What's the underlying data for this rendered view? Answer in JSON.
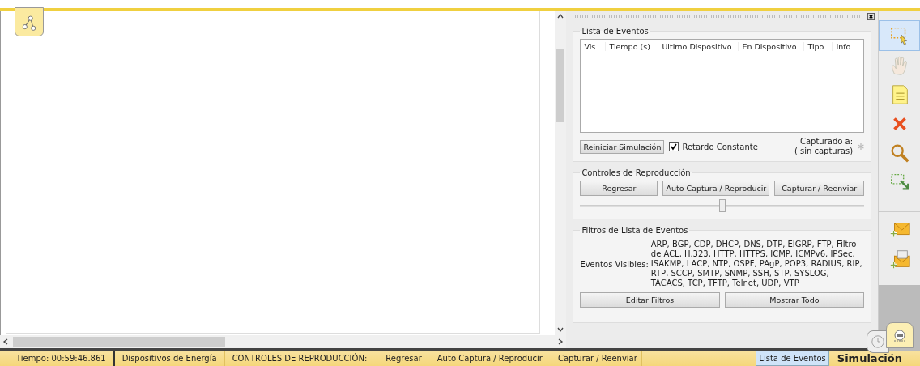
{
  "event_list": {
    "title": "Lista de Eventos",
    "columns": [
      "Vis.",
      "Tiempo (s)",
      "Ultimo Dispositivo",
      "En Dispositivo",
      "Tipo",
      "Info"
    ],
    "reset_button": "Reiniciar Simulación",
    "constant_delay": {
      "label": "Retardo Constante",
      "checked": true
    },
    "captured_label": "Capturado a:",
    "captured_value": "( sin capturas)"
  },
  "playback": {
    "title": "Controles de Reproducción",
    "buttons": [
      "Regresar",
      "Auto Captura / Reproducir",
      "Capturar / Reenviar"
    ],
    "speed": {
      "level": 0.5
    }
  },
  "filters": {
    "title": "Filtros de Lista de Eventos",
    "visible_label": "Eventos Visibles:",
    "visible_events": "ARP, BGP, CDP, DHCP, DNS, DTP, EIGRP, FTP, Filtro de ACL, H.323, HTTP, HTTPS, ICMP, ICMPv6, IPSec, ISAKMP, LACP, NTP, OSPF, PAgP, POP3, RADIUS, RIP, RTP, SCCP, SMTP, SNMP, SSH, STP, SYSLOG, TACACS, TCP, TFTP, Telnet, UDP, VTP",
    "buttons": [
      "Editar Filtros",
      "Mostrar Todo"
    ]
  },
  "toolbar": [
    {
      "kind": "select",
      "selected": true
    },
    {
      "kind": "hand",
      "selected": false
    },
    {
      "kind": "note",
      "selected": false
    },
    {
      "kind": "delete",
      "selected": false
    },
    {
      "kind": "zoom",
      "selected": false
    },
    {
      "kind": "resize",
      "selected": false
    },
    {
      "kind": "pdu",
      "selected": false
    },
    {
      "kind": "complex-pdu",
      "selected": false
    }
  ],
  "status_bar": {
    "time": "Tiempo: 00:59:46.861",
    "power": "Dispositivos de Energía",
    "playback_label": "CONTROLES DE REPRODUCCIÓN:",
    "playback_links": [
      "Regresar",
      "Auto Captura / Reproducir",
      "Capturar / Reenviar"
    ],
    "tabs": [
      {
        "label": "Lista de Eventos",
        "selected": true
      }
    ],
    "mode": "Simulación"
  }
}
